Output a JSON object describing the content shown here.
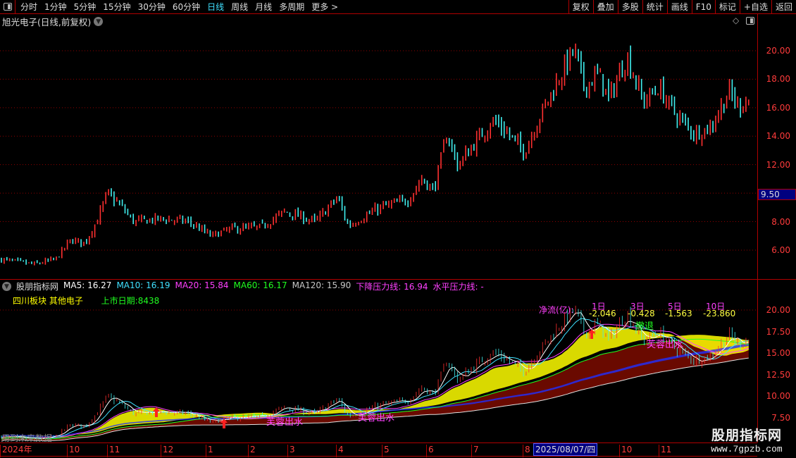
{
  "toolbar": {
    "periods": [
      {
        "label": "分时"
      },
      {
        "label": "1分钟"
      },
      {
        "label": "5分钟"
      },
      {
        "label": "15分钟"
      },
      {
        "label": "30分钟"
      },
      {
        "label": "60分钟"
      },
      {
        "label": "日线",
        "active": true
      },
      {
        "label": "周线"
      },
      {
        "label": "月线"
      },
      {
        "label": "多周期"
      },
      {
        "label": "更多 >"
      }
    ],
    "buttons": [
      "复权",
      "叠加",
      "多股",
      "统计",
      "画线",
      "F10",
      "标记",
      "+自选",
      "返回"
    ]
  },
  "chart_title": "旭光电子(日线,前复权)",
  "main_axis": {
    "labels": [
      "20.00",
      "18.00",
      "16.00",
      "14.00",
      "12.00",
      "8.00",
      "6.00"
    ],
    "current_price": "9.50"
  },
  "indicator": {
    "name": "股朋指标网",
    "values": [
      {
        "label": "MA5: 16.27",
        "color": "#ffffff"
      },
      {
        "label": "MA10: 16.19",
        "color": "#40e0ff"
      },
      {
        "label": "MA20: 15.84",
        "color": "#ff40ff"
      },
      {
        "label": "MA60: 16.17",
        "color": "#20ff20"
      },
      {
        "label": "MA120: 15.90",
        "color": "#c8c8c8"
      },
      {
        "label": "下降压力线: 16.94",
        "color": "#ff40ff"
      },
      {
        "label": "水平压力线: -",
        "color": "#ff40ff"
      }
    ],
    "sector": "四川板块  其他电子",
    "listing": "上市日期:8438",
    "netflow_label": "净流(亿):",
    "netflow": [
      {
        "period": "1日",
        "value": "-2.046"
      },
      {
        "period": "3日",
        "value": "-0.428"
      },
      {
        "period": "5日",
        "value": "-1.563"
      },
      {
        "period": "10日",
        "value": "-23.860"
      }
    ],
    "signal_retreat": "撤退",
    "signal_rise": "芙蓉出水",
    "future_data_note": "用到未来数据",
    "axis_labels": [
      "20.00",
      "17.50",
      "15.00",
      "12.50",
      "10.00",
      "7.50"
    ]
  },
  "date_axis": {
    "ticks": [
      "2024年",
      "10",
      "11",
      "12",
      "1",
      "2",
      "3",
      "4",
      "5",
      "6",
      "7",
      "8",
      "10",
      "11"
    ],
    "cursor_date": "2025/08/07/四"
  },
  "watermark": {
    "title": "股朋指标网",
    "url": "www.7gpzb.com"
  },
  "colors": {
    "up": "#ff3030",
    "down": "#40f0f0",
    "grid": "#b00000",
    "axis_text": "#ff3b3b"
  },
  "chart_data": {
    "type": "candlestick",
    "note_series": "approximate closing prices",
    "close": [
      [
        "2024-08-15",
        5.35
      ],
      [
        "2024-09-08",
        5.0
      ],
      [
        "2024-09-23",
        5.35
      ],
      [
        "2024-10-04",
        6.7
      ],
      [
        "2024-10-15",
        6.5
      ],
      [
        "2024-10-25",
        8.2
      ],
      [
        "2024-11-01",
        10.0
      ],
      [
        "2024-11-08",
        9.2
      ],
      [
        "2024-11-16",
        8.0
      ],
      [
        "2024-12-02",
        8.2
      ],
      [
        "2024-12-20",
        8.0
      ],
      [
        "2025-01-05",
        7.0
      ],
      [
        "2025-01-20",
        7.5
      ],
      [
        "2025-02-10",
        7.6
      ],
      [
        "2025-02-27",
        8.7
      ],
      [
        "2025-03-19",
        8.0
      ],
      [
        "2025-04-02",
        9.7
      ],
      [
        "2025-04-09",
        7.7
      ],
      [
        "2025-04-30",
        9.0
      ],
      [
        "2025-05-19",
        9.5
      ],
      [
        "2025-05-29",
        11.0
      ],
      [
        "2025-06-06",
        10.2
      ],
      [
        "2025-06-15",
        14.2
      ],
      [
        "2025-06-22",
        11.9
      ],
      [
        "2025-07-01",
        13.2
      ],
      [
        "2025-07-14",
        15.1
      ],
      [
        "2025-07-23",
        14.2
      ],
      [
        "2025-08-02",
        12.9
      ],
      [
        "2025-08-14",
        15.6
      ],
      [
        "2025-08-24",
        17.6
      ],
      [
        "2025-09-05",
        20.1
      ],
      [
        "2025-09-11",
        17.4
      ],
      [
        "2025-09-19",
        18.4
      ],
      [
        "2025-09-25",
        16.6
      ],
      [
        "2025-10-07",
        19.6
      ],
      [
        "2025-10-20",
        16.4
      ],
      [
        "2025-11-01",
        17.4
      ],
      [
        "2025-11-08",
        15.6
      ],
      [
        "2025-11-16",
        14.2
      ],
      [
        "2025-11-23",
        14.6
      ],
      [
        "2025-12-01",
        17.1
      ],
      [
        "2025-12-05",
        16.1
      ],
      [
        "2025-12-09",
        16.6
      ]
    ],
    "price_range": [
      4.5,
      21.5
    ],
    "indicator_range": [
      7.5,
      22
    ],
    "grid": true
  }
}
